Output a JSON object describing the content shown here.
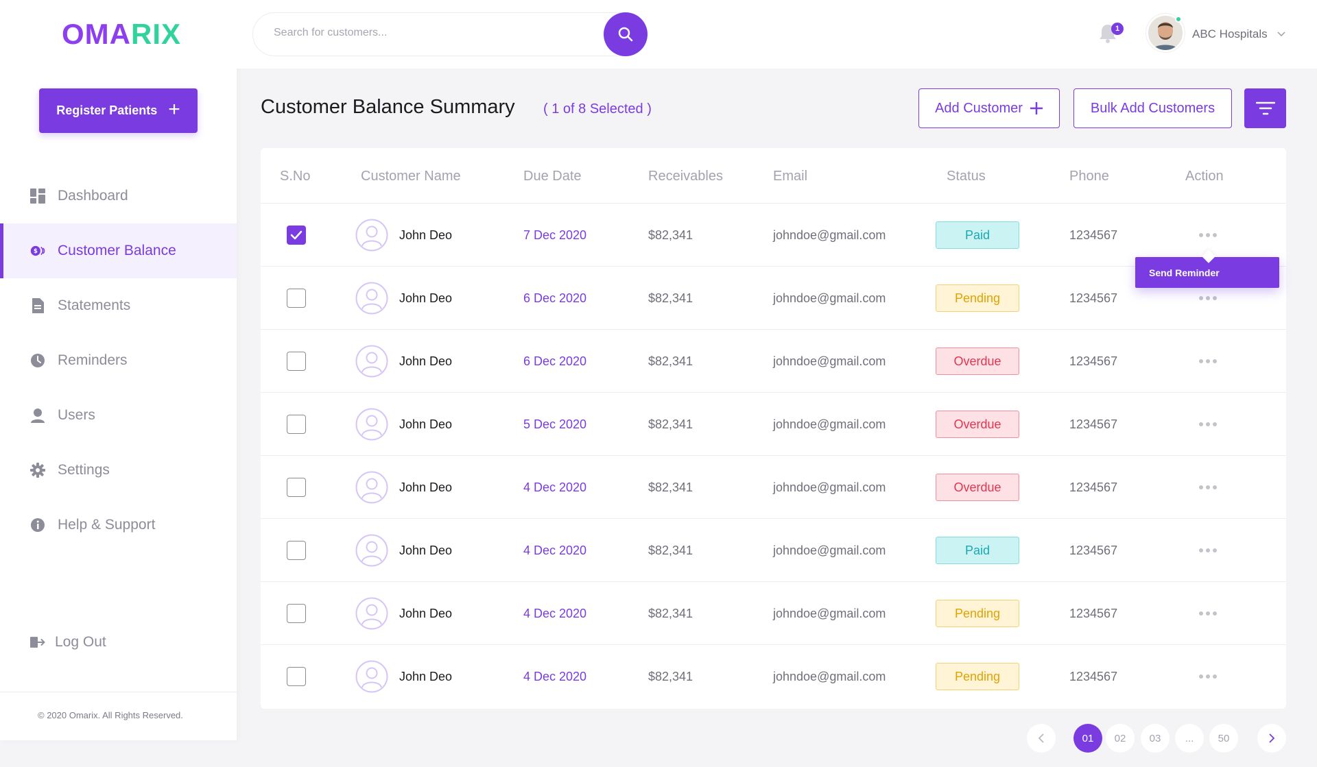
{
  "brand": {
    "part1": "OMA",
    "part2": "RIX"
  },
  "sidebar": {
    "register_label": "Register Patients",
    "items": [
      {
        "label": "Dashboard",
        "icon": "dashboard-icon"
      },
      {
        "label": "Customer Balance",
        "icon": "coin-icon",
        "active": true
      },
      {
        "label": "Statements",
        "icon": "document-icon"
      },
      {
        "label": "Reminders",
        "icon": "clock-icon"
      },
      {
        "label": "Users",
        "icon": "user-icon"
      },
      {
        "label": "Settings",
        "icon": "gear-icon"
      },
      {
        "label": "Help & Support",
        "icon": "info-icon"
      }
    ],
    "logout_label": "Log Out",
    "copyright": "© 2020 Omarix. All Rights Reserved."
  },
  "header": {
    "search_placeholder": "Search for customers...",
    "notification_count": "1",
    "org_name": "ABC Hospitals"
  },
  "main": {
    "title": "Customer Balance Summary",
    "selected_text": "( 1 of 8 Selected )",
    "add_customer_label": "Add Customer",
    "bulk_add_label": "Bulk Add Customers",
    "reminder_menu_label": "Send Reminder"
  },
  "table": {
    "columns": [
      "S.No",
      "Customer Name",
      "Due Date",
      "Receivables",
      "Email",
      "Status",
      "Phone",
      "Action"
    ],
    "rows": [
      {
        "checked": true,
        "name": "John Deo",
        "due": "7 Dec 2020",
        "receivables": "$82,341",
        "email": "johndoe@gmail.com",
        "status": "Paid",
        "phone": "1234567"
      },
      {
        "checked": false,
        "name": "John Deo",
        "due": "6 Dec 2020",
        "receivables": "$82,341",
        "email": "johndoe@gmail.com",
        "status": "Pending",
        "phone": "1234567"
      },
      {
        "checked": false,
        "name": "John Deo",
        "due": "6 Dec 2020",
        "receivables": "$82,341",
        "email": "johndoe@gmail.com",
        "status": "Overdue",
        "phone": "1234567"
      },
      {
        "checked": false,
        "name": "John Deo",
        "due": "5 Dec 2020",
        "receivables": "$82,341",
        "email": "johndoe@gmail.com",
        "status": "Overdue",
        "phone": "1234567"
      },
      {
        "checked": false,
        "name": "John Deo",
        "due": "4 Dec 2020",
        "receivables": "$82,341",
        "email": "johndoe@gmail.com",
        "status": "Overdue",
        "phone": "1234567"
      },
      {
        "checked": false,
        "name": "John Deo",
        "due": "4 Dec 2020",
        "receivables": "$82,341",
        "email": "johndoe@gmail.com",
        "status": "Paid",
        "phone": "1234567"
      },
      {
        "checked": false,
        "name": "John Deo",
        "due": "4 Dec 2020",
        "receivables": "$82,341",
        "email": "johndoe@gmail.com",
        "status": "Pending",
        "phone": "1234567"
      },
      {
        "checked": false,
        "name": "John Deo",
        "due": "4 Dec 2020",
        "receivables": "$82,341",
        "email": "johndoe@gmail.com",
        "status": "Pending",
        "phone": "1234567"
      }
    ]
  },
  "pagination": {
    "pages": [
      "01",
      "02",
      "03",
      "...",
      "50"
    ],
    "current": "01"
  },
  "colors": {
    "accent": "#7a3be0",
    "brand_green": "#2fd39b",
    "paid": "#1aa8b0",
    "pending": "#e2a100",
    "overdue": "#e3344f"
  }
}
